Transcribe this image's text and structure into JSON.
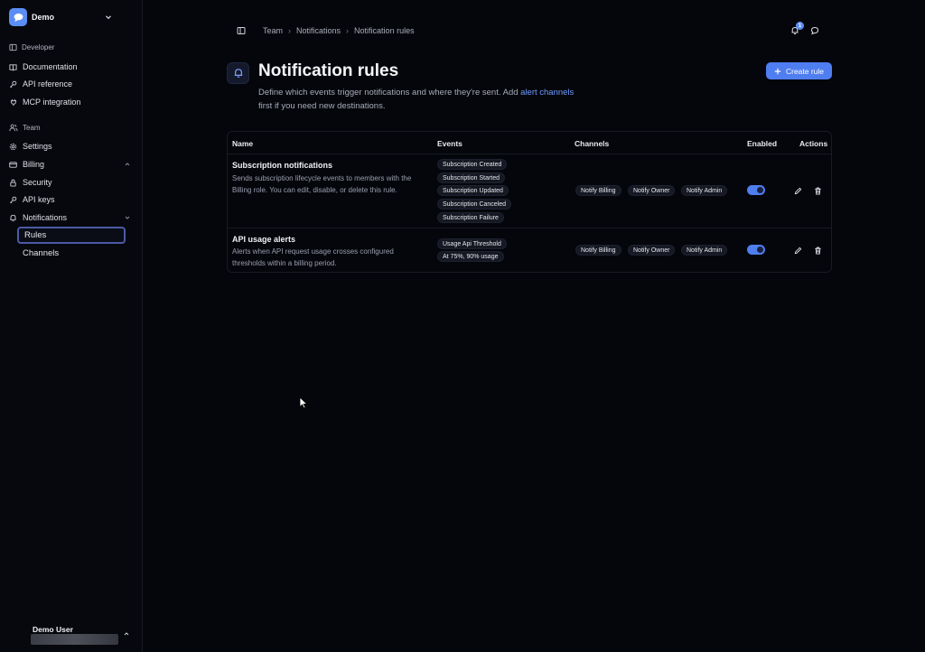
{
  "workspace": {
    "name": "Demo"
  },
  "sidebar": {
    "developer_label": "Developer",
    "developer_items": [
      {
        "label": "Documentation",
        "icon": "book-icon"
      },
      {
        "label": "API reference",
        "icon": "key-icon"
      },
      {
        "label": "MCP integration",
        "icon": "plug-icon"
      }
    ],
    "team_label": "Team",
    "team_items": [
      {
        "label": "Settings",
        "icon": "gear-icon"
      },
      {
        "label": "Billing",
        "icon": "credit-card-icon"
      },
      {
        "label": "Security",
        "icon": "lock-icon"
      },
      {
        "label": "API keys",
        "icon": "key-icon"
      },
      {
        "label": "Notifications",
        "icon": "bell-icon"
      }
    ],
    "notifications_sub": [
      {
        "label": "Rules",
        "active": true
      },
      {
        "label": "Channels",
        "active": false
      }
    ],
    "user": {
      "name": "Demo User"
    }
  },
  "breadcrumb": [
    "Team",
    "Notifications",
    "Notification rules"
  ],
  "notifications": {
    "count": "1"
  },
  "header": {
    "title": "Notification rules",
    "desc_before": "Define which events trigger notifications and where they're sent. Add ",
    "desc_link": "alert channels",
    "desc_after": " first if you need new destinations.",
    "create_label": "Create rule"
  },
  "table": {
    "columns": [
      "Name",
      "Events",
      "Channels",
      "Enabled",
      "Actions"
    ],
    "rows": [
      {
        "name": "Subscription notifications",
        "description": "Sends subscription lifecycle events to members with the Billing role. You can edit, disable, or delete this rule.",
        "events": [
          "Subscription Created",
          "Subscription Started",
          "Subscription Updated",
          "Subscription Canceled",
          "Subscription Failure"
        ],
        "channels": [
          "Notify Billing",
          "Notify Owner",
          "Notify Admin"
        ],
        "enabled": true
      },
      {
        "name": "API usage alerts",
        "description": "Alerts when API request usage crosses configured thresholds within a billing period.",
        "events": [
          "Usage Api Threshold",
          "At 75%, 90% usage"
        ],
        "channels": [
          "Notify Billing",
          "Notify Owner",
          "Notify Admin"
        ],
        "enabled": true
      }
    ]
  },
  "colors": {
    "accent": "#4f7ef0",
    "background": "#05060b"
  }
}
